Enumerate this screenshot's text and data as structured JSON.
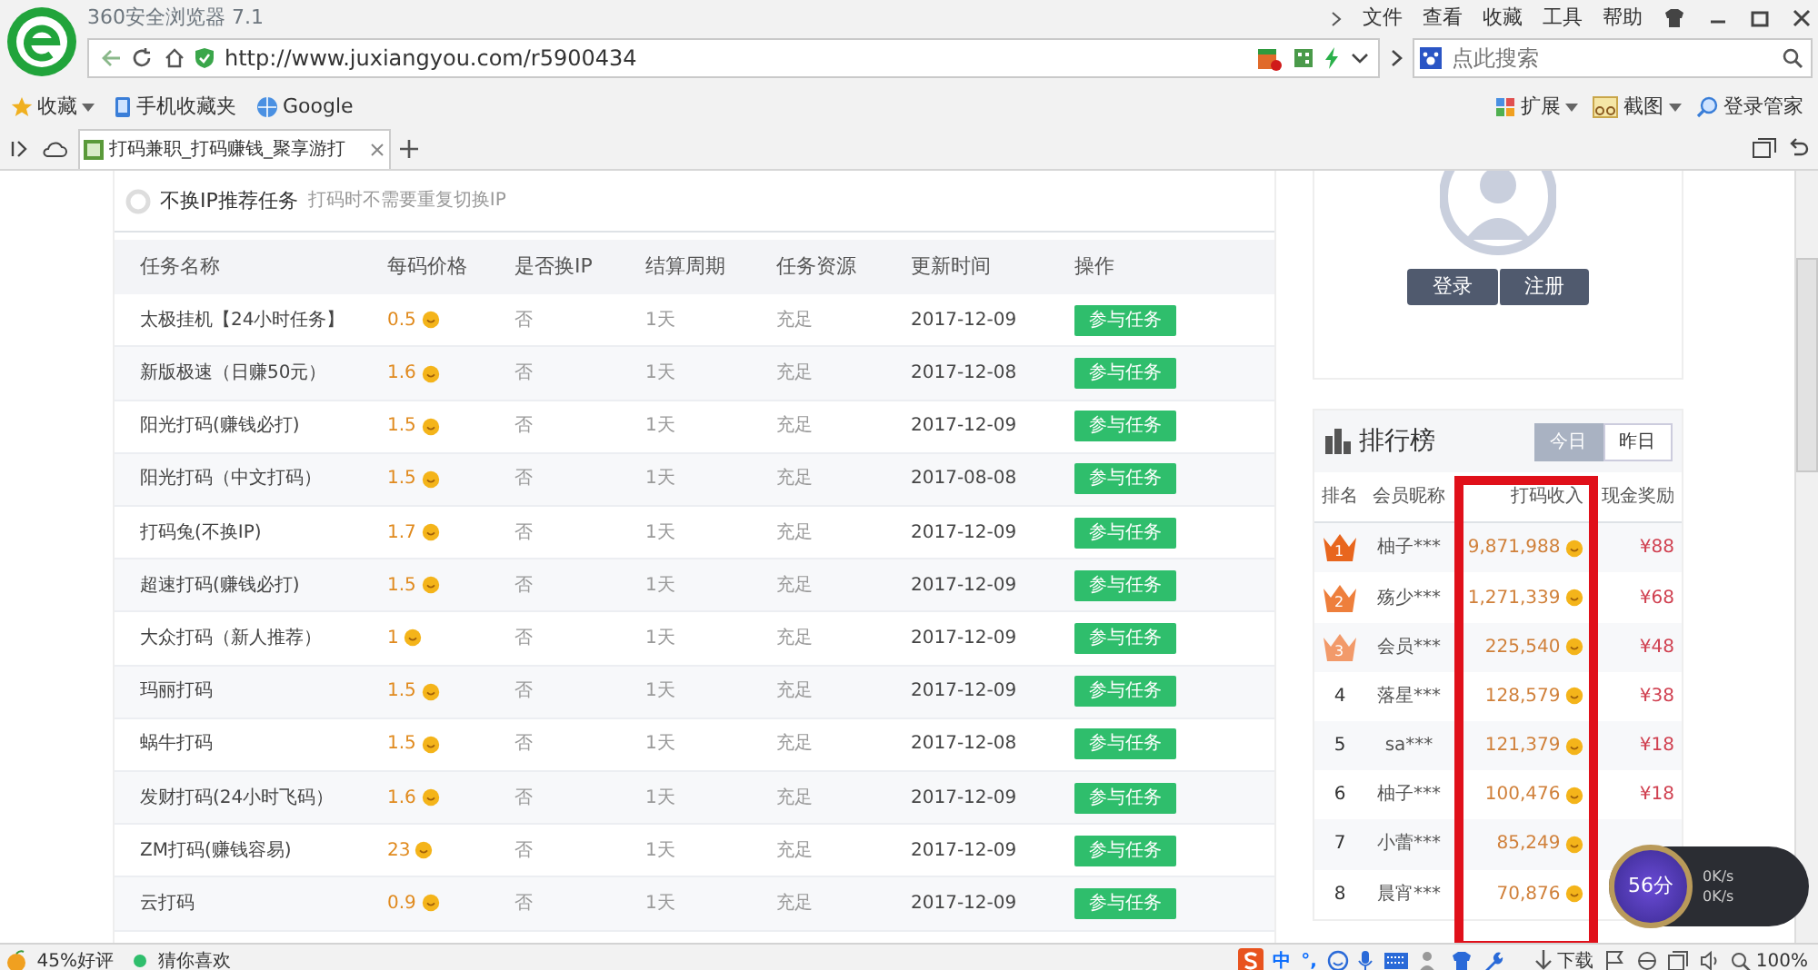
{
  "browser": {
    "title": "360安全浏览器 7.1",
    "menu": [
      "文件",
      "查看",
      "收藏",
      "工具",
      "帮助"
    ],
    "url": "http://www.juxiangyou.com/r5900434",
    "search": {
      "placeholder": "点此搜索"
    }
  },
  "bookmarks": [
    "收藏",
    "手机收藏夹",
    "Google"
  ],
  "toolbar_right": [
    "扩展",
    "截图",
    "登录管家"
  ],
  "tabs": [
    {
      "label": "打码兼职_打码赚钱_聚享游打",
      "selected": true
    }
  ],
  "section": {
    "title": "不换IP推荐任务",
    "subtitle": "打码时不需要重复切换IP"
  },
  "table": {
    "columns": [
      "任务名称",
      "每码价格",
      "是否换IP",
      "结算周期",
      "任务资源",
      "更新时间",
      "操作"
    ],
    "rows": [
      {
        "name": "太极挂机【24小时任务】",
        "price": "0.5",
        "ip": "否",
        "cycle": "1天",
        "resource": "充足",
        "date": "2017-12-09",
        "action": "参与任务"
      },
      {
        "name": "新版极速（日赚50元）",
        "price": "1.6",
        "ip": "否",
        "cycle": "1天",
        "resource": "充足",
        "date": "2017-12-08",
        "action": "参与任务"
      },
      {
        "name": "阳光打码(赚钱必打)",
        "price": "1.5",
        "ip": "否",
        "cycle": "1天",
        "resource": "充足",
        "date": "2017-12-09",
        "action": "参与任务"
      },
      {
        "name": "阳光打码（中文打码）",
        "price": "1.5",
        "ip": "否",
        "cycle": "1天",
        "resource": "充足",
        "date": "2017-08-08",
        "action": "参与任务"
      },
      {
        "name": "打码兔(不换IP)",
        "price": "1.7",
        "ip": "否",
        "cycle": "1天",
        "resource": "充足",
        "date": "2017-12-09",
        "action": "参与任务"
      },
      {
        "name": "超速打码(赚钱必打)",
        "price": "1.5",
        "ip": "否",
        "cycle": "1天",
        "resource": "充足",
        "date": "2017-12-09",
        "action": "参与任务"
      },
      {
        "name": "大众打码（新人推荐）",
        "price": "1",
        "ip": "否",
        "cycle": "1天",
        "resource": "充足",
        "date": "2017-12-09",
        "action": "参与任务"
      },
      {
        "name": "玛丽打码",
        "price": "1.5",
        "ip": "否",
        "cycle": "1天",
        "resource": "充足",
        "date": "2017-12-09",
        "action": "参与任务"
      },
      {
        "name": "蜗牛打码",
        "price": "1.5",
        "ip": "否",
        "cycle": "1天",
        "resource": "充足",
        "date": "2017-12-08",
        "action": "参与任务"
      },
      {
        "name": "发财打码(24小时飞码）",
        "price": "1.6",
        "ip": "否",
        "cycle": "1天",
        "resource": "充足",
        "date": "2017-12-09",
        "action": "参与任务"
      },
      {
        "name": "ZM打码(赚钱容易)",
        "price": "23",
        "ip": "否",
        "cycle": "1天",
        "resource": "充足",
        "date": "2017-12-09",
        "action": "参与任务"
      },
      {
        "name": "云打码",
        "price": "0.9",
        "ip": "否",
        "cycle": "1天",
        "resource": "充足",
        "date": "2017-12-09",
        "action": "参与任务"
      }
    ]
  },
  "account": {
    "buttons": [
      "登录",
      "注册"
    ]
  },
  "ranking": {
    "title": "排行榜",
    "tabs": [
      {
        "label": "今日",
        "selected": true
      },
      {
        "label": "昨日",
        "selected": false
      }
    ],
    "columns": [
      "排名",
      "会员昵称",
      "打码收入",
      "现金奖励"
    ],
    "rows": [
      {
        "kind": "crown",
        "rank": "1",
        "color": "#e8661e",
        "name": "柚子***",
        "income": "9,871,988",
        "reward": "¥88"
      },
      {
        "kind": "crown",
        "rank": "2",
        "color": "#ee7f3c",
        "name": "殇少***",
        "income": "1,271,339",
        "reward": "¥68"
      },
      {
        "kind": "crown",
        "rank": "3",
        "color": "#f29a6a",
        "name": "会员***",
        "income": "225,540",
        "reward": "¥48"
      },
      {
        "kind": "number",
        "rank": "4",
        "name": "落星***",
        "income": "128,579",
        "reward": "¥38"
      },
      {
        "kind": "number",
        "rank": "5",
        "name": "sa***",
        "income": "121,379",
        "reward": "¥18"
      },
      {
        "kind": "number",
        "rank": "6",
        "name": "柚子***",
        "income": "100,476",
        "reward": "¥18"
      },
      {
        "kind": "number",
        "rank": "7",
        "name": "小蕾***",
        "income": "85,249"
      },
      {
        "kind": "number",
        "rank": "8",
        "name": "晨宵***",
        "income": "70,876"
      }
    ]
  },
  "speed_widget": {
    "score": "56分",
    "upload": "0K/s",
    "download": "0K/s"
  },
  "status_bar": {
    "rating": "45%好评",
    "recommend": "猜你喜欢",
    "ime": "中",
    "punct": "°,",
    "download": "下载",
    "zoom": "100%"
  }
}
